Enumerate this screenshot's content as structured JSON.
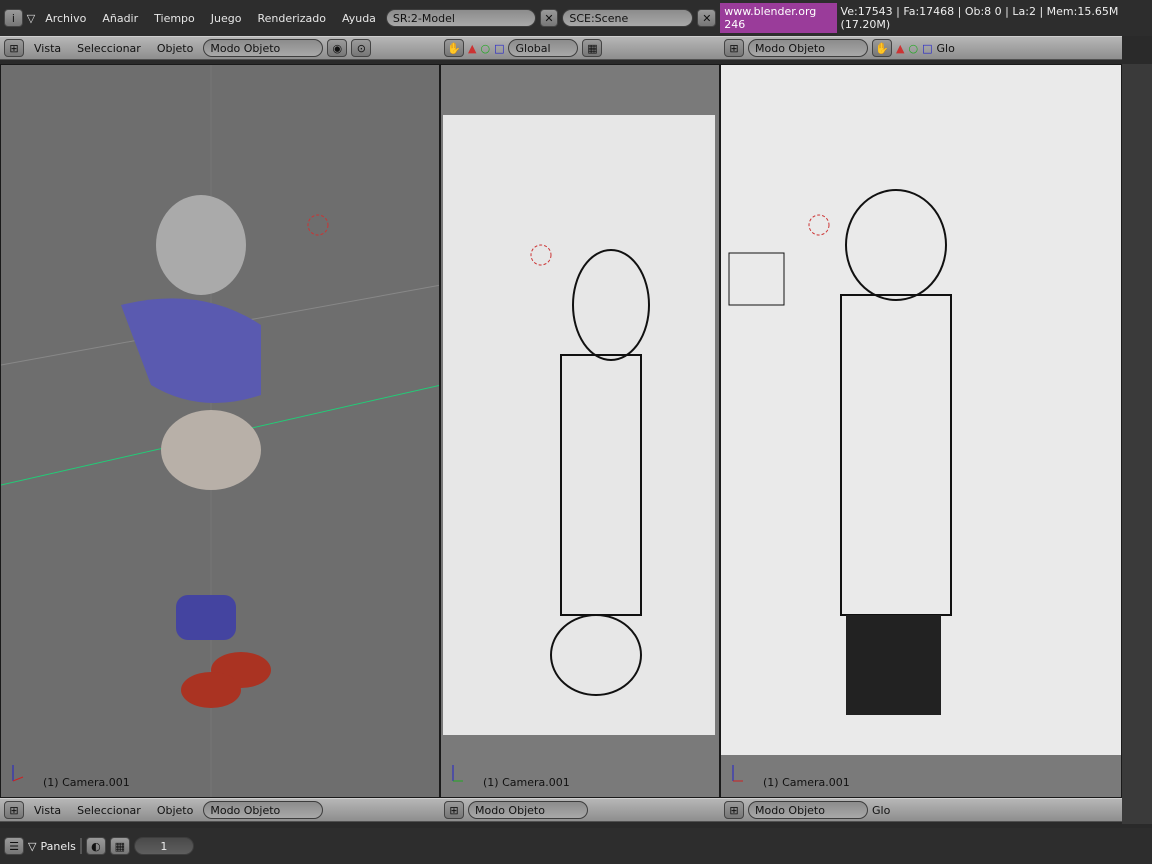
{
  "top": {
    "menus": [
      "Archivo",
      "Añadir",
      "Tiempo",
      "Juego",
      "Renderizado",
      "Ayuda"
    ],
    "screen": "SR:2-Model",
    "scene": "SCE:Scene",
    "url": "www.blender.org 246",
    "stats": "Ve:17543 | Fa:17468 | Ob:8 0 | La:2 | Mem:15.65M (17.20M)"
  },
  "header": {
    "menus": [
      "Vista",
      "Seleccionar",
      "Objeto"
    ],
    "mode": "Modo Objeto",
    "orientation": "Global",
    "orientation_short": "Glo"
  },
  "viewports": [
    {
      "label": "(1) Camera.001"
    },
    {
      "label": "(1) Camera.001"
    },
    {
      "label": "(1) Camera.001"
    }
  ],
  "bottom": {
    "panels": "Panels",
    "frame": "1"
  },
  "icons": [
    "info-icon",
    "crosshair-icon",
    "hand-icon",
    "triangle-icon",
    "circle-icon",
    "square-icon",
    "layers-icon",
    "camera-icon"
  ]
}
